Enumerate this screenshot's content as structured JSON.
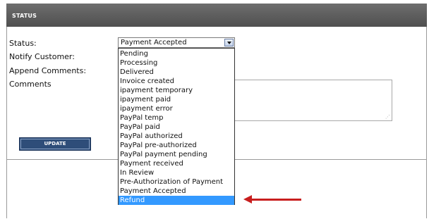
{
  "header": {
    "title": "STATUS"
  },
  "form": {
    "status_label": "Status:",
    "notify_label": "Notify Customer:",
    "append_label": "Append Comments:",
    "comments_label": "Comments",
    "status_value": "Payment Accepted",
    "update_label": "UPDATE"
  },
  "dropdown": {
    "options": [
      {
        "label": "Pending",
        "selected": false
      },
      {
        "label": "Processing",
        "selected": false
      },
      {
        "label": "Delivered",
        "selected": false
      },
      {
        "label": "Invoice created",
        "selected": false
      },
      {
        "label": "ipayment temporary",
        "selected": false
      },
      {
        "label": "ipayment paid",
        "selected": false
      },
      {
        "label": "ipayment error",
        "selected": false
      },
      {
        "label": "PayPal temp",
        "selected": false
      },
      {
        "label": "PayPal paid",
        "selected": false
      },
      {
        "label": "PayPal authorized",
        "selected": false
      },
      {
        "label": "PayPal pre-authorized",
        "selected": false
      },
      {
        "label": "PayPal payment pending",
        "selected": false
      },
      {
        "label": "Payment received",
        "selected": false
      },
      {
        "label": "In Review",
        "selected": false
      },
      {
        "label": "Pre-Authorization of Payment",
        "selected": false
      },
      {
        "label": "Payment Accepted",
        "selected": false
      },
      {
        "label": "Refund",
        "selected": true
      }
    ]
  },
  "colors": {
    "header_bg": "#555555",
    "button_bg": "#2e4d79",
    "highlight": "#3399ff",
    "annotation_arrow": "#c81e1e"
  }
}
